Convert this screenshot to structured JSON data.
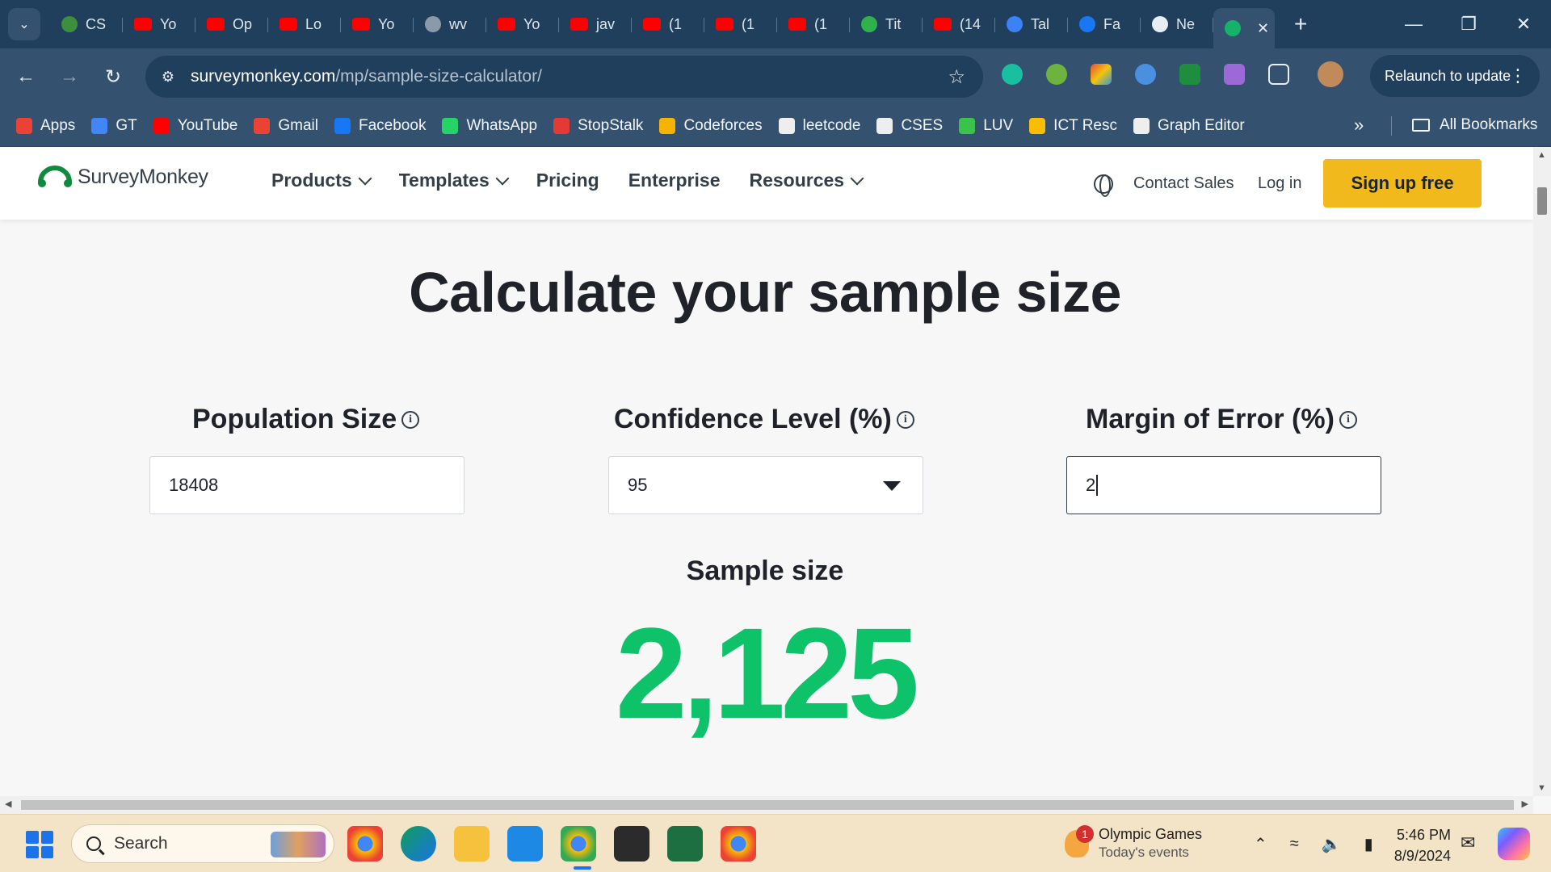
{
  "browser": {
    "tabs": [
      {
        "label": "CS",
        "icon": "w-icon",
        "color": "#3c8f3c"
      },
      {
        "label": "Yo",
        "icon": "youtube-icon",
        "color": "#ff0000"
      },
      {
        "label": "Op",
        "icon": "youtube-icon",
        "color": "#ff0000"
      },
      {
        "label": "Lo",
        "icon": "youtube-icon",
        "color": "#ff0000"
      },
      {
        "label": "Yo",
        "icon": "youtube-icon",
        "color": "#ff0000"
      },
      {
        "label": "wv",
        "icon": "video-icon",
        "color": "#8a9aa8"
      },
      {
        "label": "Yo",
        "icon": "youtube-icon",
        "color": "#ff0000"
      },
      {
        "label": "jav",
        "icon": "youtube-icon",
        "color": "#ff0000"
      },
      {
        "label": "(1",
        "icon": "youtube-icon",
        "color": "#ff0000"
      },
      {
        "label": "(1",
        "icon": "youtube-icon",
        "color": "#ff0000"
      },
      {
        "label": "(1",
        "icon": "youtube-icon",
        "color": "#ff0000"
      },
      {
        "label": "Tit",
        "icon": "leetcode-icon",
        "color": "#2fb14b"
      },
      {
        "label": "(14",
        "icon": "youtube-icon",
        "color": "#ff0000"
      },
      {
        "label": "Tal",
        "icon": "grid-icon",
        "color": "#3b82f6"
      },
      {
        "label": "Fa",
        "icon": "facebook-icon",
        "color": "#1877f2"
      },
      {
        "label": "Ne",
        "icon": "chrome-icon",
        "color": "#e8eef5"
      }
    ],
    "active_tab": {
      "icon": "surveymonkey-icon",
      "color": "#17b26a"
    },
    "url": {
      "domain": "surveymonkey.com",
      "path": "/mp/sample-size-calculator/"
    },
    "relaunch_label": "Relaunch to update",
    "bookmarks": [
      {
        "label": "Apps",
        "color": "#ea4335"
      },
      {
        "label": "GT",
        "color": "#4285f4"
      },
      {
        "label": "YouTube",
        "color": "#ff0000"
      },
      {
        "label": "Gmail",
        "color": "#ea4335"
      },
      {
        "label": "Facebook",
        "color": "#1877f2"
      },
      {
        "label": "WhatsApp",
        "color": "#25d366"
      },
      {
        "label": "StopStalk",
        "color": "#e53935"
      },
      {
        "label": "Codeforces",
        "color": "#f4b400"
      },
      {
        "label": "leetcode",
        "color": "#eeeeee"
      },
      {
        "label": "CSES",
        "color": "#eeeeee"
      },
      {
        "label": "LUV",
        "color": "#3ac24a"
      },
      {
        "label": "ICT Resc",
        "color": "#fbbc04"
      },
      {
        "label": "Graph Editor",
        "color": "#eeeeee"
      }
    ],
    "bookmarks_more": "»",
    "all_bookmarks_label": "All Bookmarks"
  },
  "site": {
    "brand": "SurveyMonkey",
    "nav": [
      {
        "label": "Products",
        "dropdown": true
      },
      {
        "label": "Templates",
        "dropdown": true
      },
      {
        "label": "Pricing",
        "dropdown": false
      },
      {
        "label": "Enterprise",
        "dropdown": false
      },
      {
        "label": "Resources",
        "dropdown": true
      }
    ],
    "contact_label": "Contact Sales",
    "login_label": "Log in",
    "signup_label": "Sign up free",
    "accent_color": "#f2b91c"
  },
  "calculator": {
    "title": "Calculate your sample size",
    "population": {
      "label": "Population Size",
      "value": "18408"
    },
    "confidence": {
      "label": "Confidence Level (%)",
      "value": "95"
    },
    "margin": {
      "label": "Margin of Error (%)",
      "value": "2"
    },
    "result_label": "Sample size",
    "result_value": "2,125",
    "result_color": "#0ec26a"
  },
  "taskbar": {
    "search_placeholder": "Search",
    "news_title": "Olympic Games",
    "news_subtitle": "Today's events",
    "news_badge": "1",
    "time": "5:46 PM",
    "date": "8/9/2024"
  }
}
